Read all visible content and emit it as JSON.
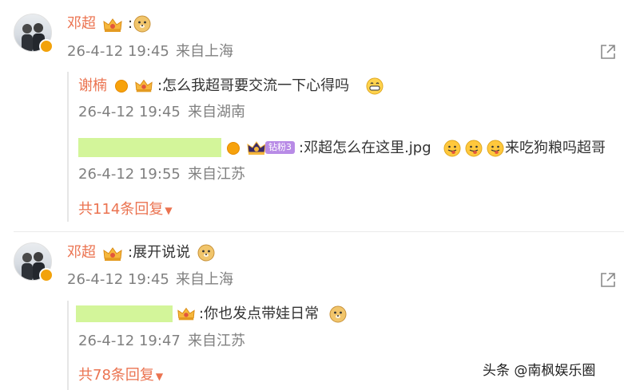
{
  "comments": [
    {
      "author": "邓超",
      "text": ":",
      "time": "26-4-12 19:45",
      "location": "来自上海",
      "replies": [
        {
          "author": "谢楠",
          "text": ":怎么我超哥要交流一下心得吗",
          "time": "26-4-12 19:45",
          "location": "来自湖南"
        },
        {
          "author": "",
          "fan_badge": "钻粉3",
          "text": ":邓超怎么在这里.jpg",
          "text2": "来吃狗粮吗超哥",
          "time": "26-4-12 19:55",
          "location": "来自江苏"
        }
      ],
      "more_replies": "共114条回复"
    },
    {
      "author": "邓超",
      "text": ":展开说说",
      "time": "26-4-12 19:45",
      "location": "来自上海",
      "replies": [
        {
          "author": "",
          "text": ":你也发点带娃日常",
          "time": "26-4-12 19:47",
          "location": "来自江苏"
        }
      ],
      "more_replies": "共78条回复"
    }
  ],
  "watermark": "头条 @南枫娱乐圈",
  "icons": {
    "share": "share-icon",
    "more_arrow": "caret-down-icon",
    "vip": "crown-icon",
    "verified": "verified-v-icon",
    "doge": "doge-emoji",
    "tongue": "tongue-emoji",
    "grin": "grin-emoji"
  },
  "colors": {
    "name": "#eb7350",
    "text": "#333333",
    "meta": "#808080",
    "redaction": "#d3f59a"
  }
}
